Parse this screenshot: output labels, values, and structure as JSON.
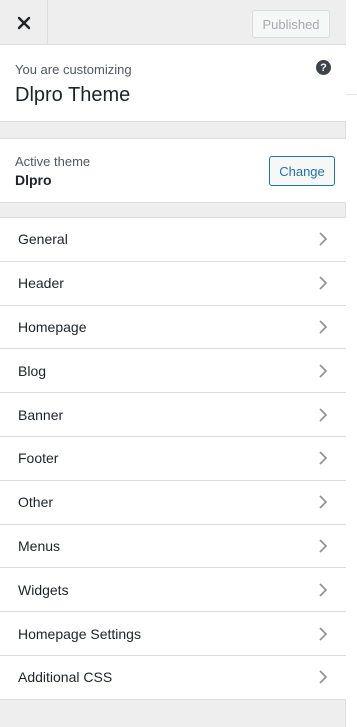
{
  "header": {
    "close_icon": "close-icon",
    "publish_label": "Published"
  },
  "info": {
    "label": "You are customizing",
    "title": "Dlpro Theme",
    "help_icon": "?"
  },
  "theme": {
    "label": "Active theme",
    "name": "Dlpro",
    "change_label": "Change"
  },
  "menu": {
    "items": [
      {
        "label": "General"
      },
      {
        "label": "Header"
      },
      {
        "label": "Homepage"
      },
      {
        "label": "Blog"
      },
      {
        "label": "Banner"
      },
      {
        "label": "Footer"
      },
      {
        "label": "Other"
      },
      {
        "label": "Menus"
      },
      {
        "label": "Widgets"
      },
      {
        "label": "Homepage Settings"
      },
      {
        "label": "Additional CSS"
      }
    ]
  },
  "colors": {
    "accent": "#2271b1",
    "panel_bg": "#eeeeee",
    "text": "#1d2327"
  }
}
